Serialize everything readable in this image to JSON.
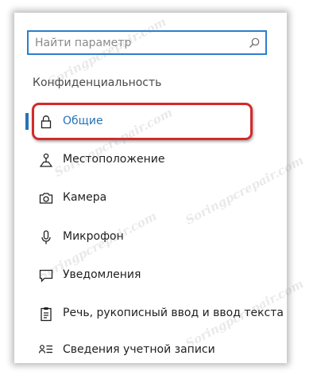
{
  "search": {
    "placeholder": "Найти параметр",
    "icon": "search-icon"
  },
  "section_title": "Конфиденциальность",
  "items": [
    {
      "label": "Общие",
      "icon": "lock-icon",
      "selected": true
    },
    {
      "label": "Местоположение",
      "icon": "location-icon",
      "selected": false
    },
    {
      "label": "Камера",
      "icon": "camera-icon",
      "selected": false
    },
    {
      "label": "Микрофон",
      "icon": "microphone-icon",
      "selected": false
    },
    {
      "label": "Уведомления",
      "icon": "notification-icon",
      "selected": false
    },
    {
      "label": "Речь, рукописный ввод и ввод текста",
      "icon": "clipboard-icon",
      "selected": false
    },
    {
      "label": "Сведения учетной записи",
      "icon": "account-info-icon",
      "selected": false
    }
  ],
  "colors": {
    "accent": "#2673b8",
    "search_border": "#2b7fd0",
    "highlight": "#d42a2a"
  },
  "watermark": "Soringpcrepair.com"
}
